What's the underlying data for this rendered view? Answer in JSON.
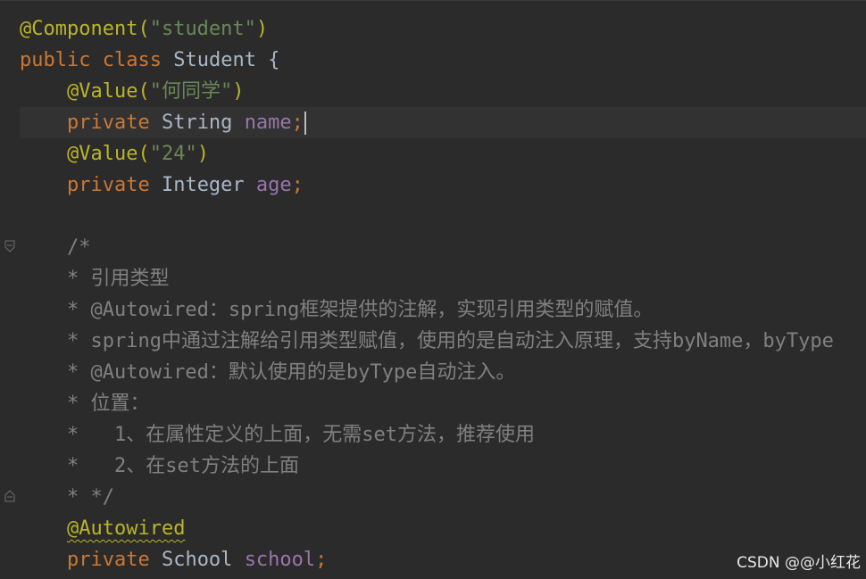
{
  "code": {
    "l1": {
      "ann": "@Component(",
      "str": "\"student\"",
      "close": ")"
    },
    "l2": {
      "kw1": "public",
      "kw2": "class",
      "name": "Student",
      "brace": "{"
    },
    "l3": {
      "ann": "@Value(",
      "str": "\"何同学\"",
      "close": ")"
    },
    "l4": {
      "kw": "private",
      "type": "String",
      "field": "name",
      "semi": ";"
    },
    "l5": {
      "ann": "@Value(",
      "str": "\"24\"",
      "close": ")"
    },
    "l6": {
      "kw": "private",
      "type": "Integer",
      "field": "age",
      "semi": ";"
    },
    "comment": [
      "/*",
      "* 引用类型",
      "* @Autowired：spring框架提供的注解，实现引用类型的赋值。",
      "* spring中通过注解给引用类型赋值，使用的是自动注入原理，支持byName，byType",
      "* @Autowired：默认使用的是byType自动注入。",
      "* 位置：",
      "*   1、在属性定义的上面，无需set方法，推荐使用",
      "*   2、在set方法的上面",
      "* */"
    ],
    "l16": {
      "ann": "@Autowired"
    },
    "l17": {
      "kw": "private",
      "type": "School",
      "field": "school",
      "semi": ";"
    }
  },
  "watermark": "CSDN @@小红花",
  "colors": {
    "background": "#2b2b2b",
    "annotation": "#bbb529",
    "keyword": "#cc7832",
    "string": "#6a8759",
    "field": "#9876aa",
    "text": "#a9b7c6",
    "comment": "#808080"
  },
  "icons": [
    "fold-start-icon",
    "fold-end-icon"
  ]
}
